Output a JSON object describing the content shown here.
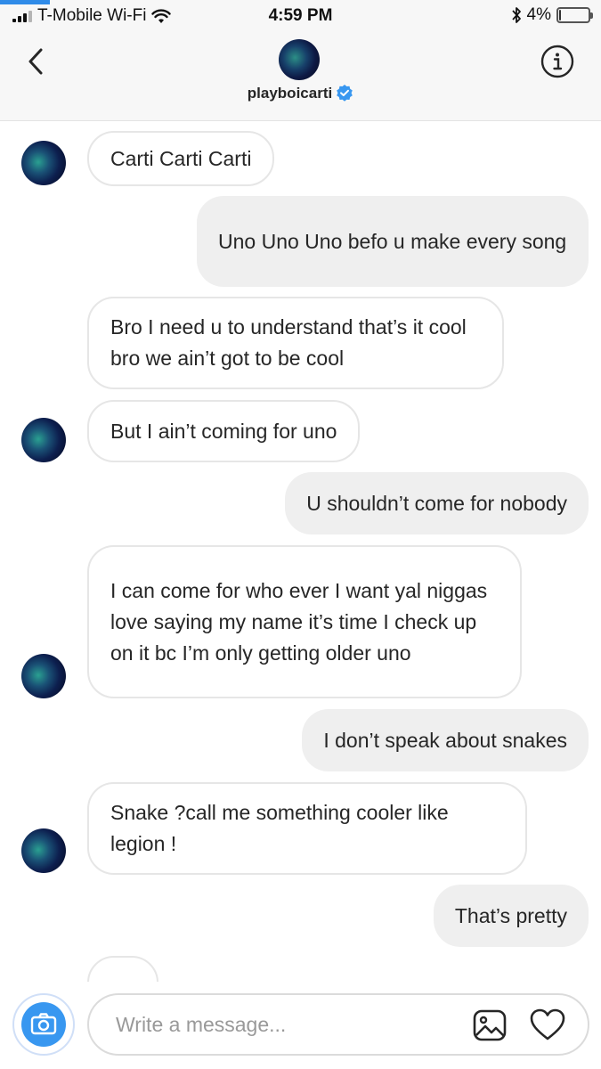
{
  "status_bar": {
    "carrier": "T-Mobile Wi-Fi",
    "time": "4:59 PM",
    "battery_percent": "4%",
    "battery_level": 0.04,
    "icons": [
      "signal-icon",
      "wifi-icon",
      "bluetooth-icon",
      "battery-icon"
    ]
  },
  "header": {
    "username": "playboicarti",
    "verified": true,
    "icons": [
      "back-chevron-icon",
      "info-icon",
      "verified-badge-icon"
    ],
    "accent_color": "#3897f0"
  },
  "messages": [
    {
      "sender": "them",
      "text": "Carti Carti Carti"
    },
    {
      "sender": "me",
      "text": "Uno Uno Uno befo u make every song"
    },
    {
      "sender": "them",
      "text": "Bro I need u to understand that’s it cool bro we ain’t got to be cool"
    },
    {
      "sender": "them",
      "text": "But I ain’t coming for uno"
    },
    {
      "sender": "me",
      "text": "U shouldn’t come for nobody"
    },
    {
      "sender": "them",
      "text": "I can come for who ever I want yal niggas love saying my name it’s time I check up on it bc I’m only getting older uno"
    },
    {
      "sender": "me",
      "text": "I don’t speak about snakes"
    },
    {
      "sender": "them",
      "text": "Snake ?call me something cooler like legion !"
    },
    {
      "sender": "me",
      "text": "That’s pretty"
    }
  ],
  "composer": {
    "placeholder": "Write a message...",
    "icons": [
      "camera-icon",
      "gallery-icon",
      "heart-icon"
    ]
  },
  "colors": {
    "incoming_bubble": "#ffffff",
    "outgoing_bubble": "#efefef",
    "camera_button": "#3897f0"
  }
}
